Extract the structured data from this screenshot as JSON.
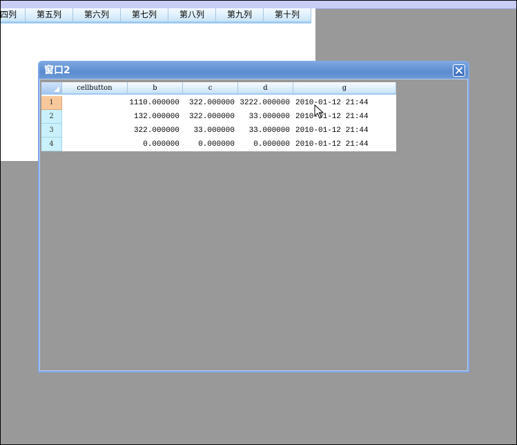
{
  "background_grid": {
    "columns": [
      "四列",
      "第五列",
      "第六列",
      "第七列",
      "第八列",
      "第九列",
      "第十列"
    ]
  },
  "dialog": {
    "title": "窗口2",
    "close_icon": "close-x-icon",
    "grid": {
      "columns": [
        "cellbutton",
        "b",
        "c",
        "d",
        "g"
      ],
      "rows": [
        {
          "num": "1",
          "cellbutton": "",
          "b": "1110.000000",
          "c": "322.000000",
          "d": "3222.000000",
          "g": "2010-01-12 21:44"
        },
        {
          "num": "2",
          "cellbutton": "",
          "b": "132.000000",
          "c": "322.000000",
          "d": "33.000000",
          "g": "2010-01-12 21:44"
        },
        {
          "num": "3",
          "cellbutton": "",
          "b": "322.000000",
          "c": "33.000000",
          "d": "33.000000",
          "g": "2010-01-12 21:44"
        },
        {
          "num": "4",
          "cellbutton": "",
          "b": "0.000000",
          "c": "0.000000",
          "d": "0.000000",
          "g": "2010-01-12 21:44"
        }
      ],
      "selected_row": "1"
    }
  },
  "colors": {
    "desktop": "#999999",
    "titlebar": "#5b8cd0",
    "row_header": "#c9f1fb",
    "row_header_selected": "#f8c89a"
  }
}
